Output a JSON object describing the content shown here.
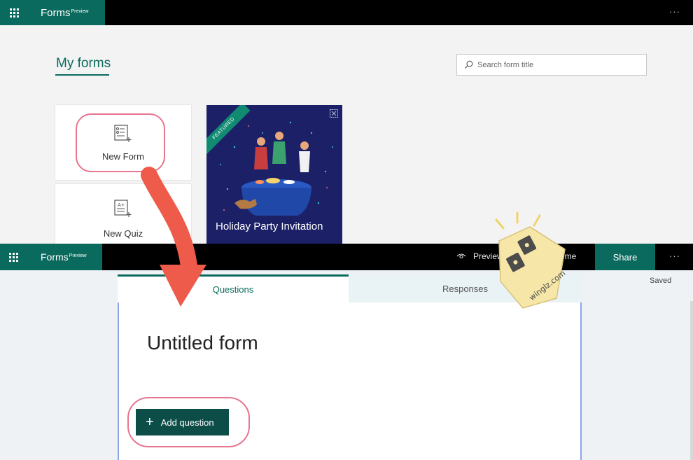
{
  "top": {
    "app_name": "Forms",
    "app_badge": "Preview",
    "more": "···",
    "section_title": "My forms",
    "search_placeholder": "Search form title",
    "new_form_label": "New Form",
    "new_quiz_label": "New Quiz",
    "featured_card": {
      "ribbon": "FEATURED",
      "title": "Holiday Party Invitation"
    }
  },
  "editor": {
    "app_name": "Forms",
    "app_badge": "Preview",
    "preview_label": "Preview",
    "theme_label": "Theme",
    "share_label": "Share",
    "more": "···",
    "saved_status": "Saved",
    "tabs": [
      {
        "label": "Questions",
        "active": true
      },
      {
        "label": "Responses",
        "active": false
      }
    ],
    "form_title": "Untitled form",
    "add_question_label": "Add question"
  },
  "watermark": {
    "text": "winglz.com"
  },
  "colors": {
    "brand": "#0b6a5e",
    "dark_button": "#0d4d48",
    "highlight_ring": "#e6758e",
    "arrow": "#ee5b4a",
    "card_navy": "#1c2167"
  },
  "icons": {
    "new_form": "form-list-icon",
    "new_quiz": "quiz-icon",
    "search": "search-icon",
    "preview": "eye-icon",
    "theme": "palette-icon",
    "waffle": "app-launcher-icon"
  }
}
